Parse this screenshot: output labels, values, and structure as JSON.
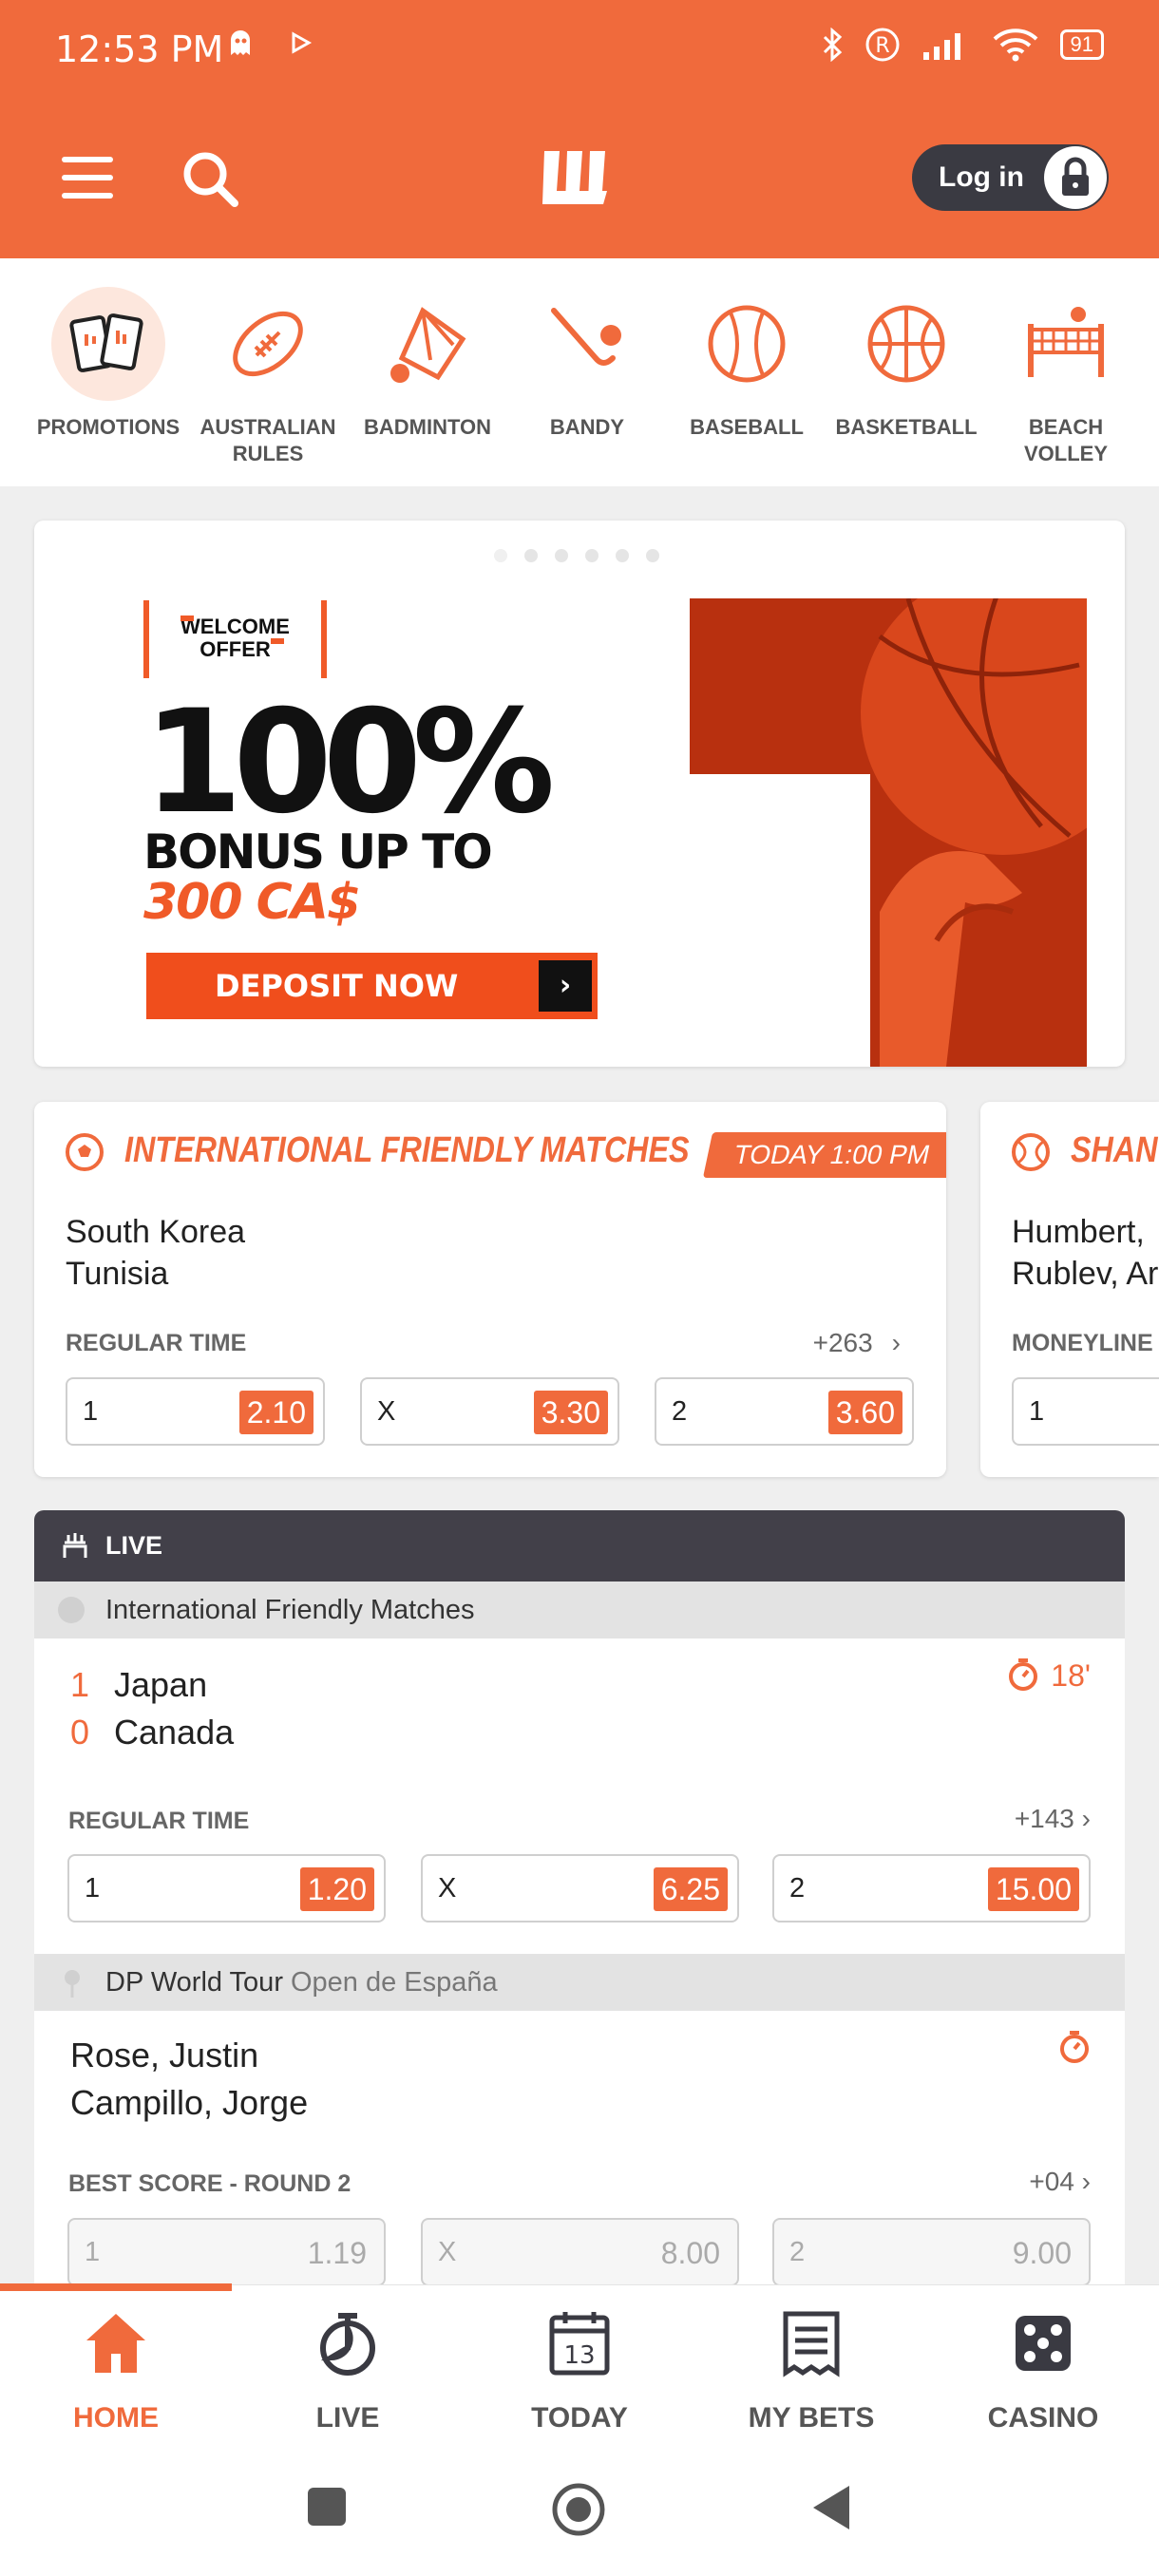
{
  "status": {
    "time": "12:53 PM",
    "battery": "91"
  },
  "header": {
    "login_label": "Log in"
  },
  "sports": [
    {
      "label": "PROMOTIONS",
      "icon": "promotions-icon"
    },
    {
      "label": "AUSTRALIAN RULES",
      "icon": "australian-football-icon"
    },
    {
      "label": "BADMINTON",
      "icon": "shuttlecock-icon"
    },
    {
      "label": "BANDY",
      "icon": "bandy-stick-icon"
    },
    {
      "label": "BASEBALL",
      "icon": "baseball-icon"
    },
    {
      "label": "BASKETBALL",
      "icon": "basketball-icon"
    },
    {
      "label": "BEACH VOLLEY",
      "icon": "beach-volley-net-icon"
    }
  ],
  "banner": {
    "welcome": "WELCOME OFFER",
    "headline": "100%",
    "bonus": "BONUS UP TO",
    "amount": "300 CA$",
    "cta": "DEPOSIT NOW"
  },
  "match_card": {
    "competition": "INTERNATIONAL FRIENDLY MATCHES",
    "time": "TODAY 1:00 PM",
    "team1": "South Korea",
    "team2": "Tunisia",
    "market": "REGULAR TIME",
    "more": "+263",
    "odds": [
      {
        "label": "1",
        "value": "2.10"
      },
      {
        "label": "X",
        "value": "3.30"
      },
      {
        "label": "2",
        "value": "3.60"
      }
    ]
  },
  "match_card_2": {
    "competition": "SHANG",
    "team1": "Humbert,",
    "team2": "Rublev, Ar",
    "market": "MONEYLINE",
    "odd_label": "1"
  },
  "live": {
    "header": "LIVE",
    "event1": {
      "competition": "International Friendly Matches",
      "team1": "Japan",
      "score1": "1",
      "team2": "Canada",
      "score2": "0",
      "clock": "18'",
      "market": "REGULAR TIME",
      "more": "+143",
      "odds": [
        {
          "label": "1",
          "value": "1.20"
        },
        {
          "label": "X",
          "value": "6.25"
        },
        {
          "label": "2",
          "value": "15.00"
        }
      ]
    },
    "event2": {
      "competition": "DP World Tour",
      "subcompetition": "Open de España",
      "team1": "Rose, Justin",
      "team2": "Campillo, Jorge",
      "market": "BEST SCORE - ROUND 2",
      "more": "+04",
      "odds": [
        {
          "label": "1",
          "value": "1.19"
        },
        {
          "label": "X",
          "value": "8.00"
        },
        {
          "label": "2",
          "value": "9.00"
        }
      ]
    }
  },
  "nav": [
    {
      "label": "HOME",
      "icon": "home-icon",
      "active": true
    },
    {
      "label": "LIVE",
      "icon": "stopwatch-icon"
    },
    {
      "label": "TODAY",
      "icon": "calendar-icon",
      "day": "13"
    },
    {
      "label": "MY BETS",
      "icon": "bet-slip-icon"
    },
    {
      "label": "CASINO",
      "icon": "dice-icon"
    }
  ],
  "colors": {
    "accent": "#f06a3c",
    "dark": "#424049"
  }
}
